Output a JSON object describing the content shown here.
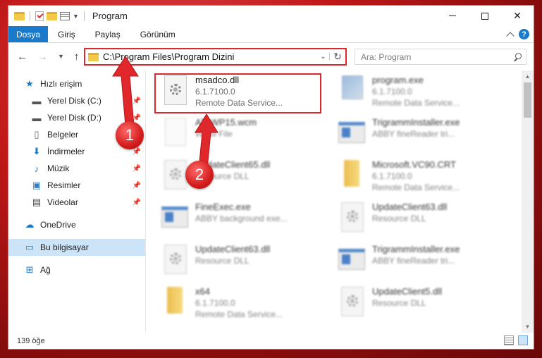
{
  "window": {
    "title": "Program"
  },
  "ribbon": {
    "tabs": [
      "Dosya",
      "Giriş",
      "Paylaş",
      "Görünüm"
    ],
    "help": "?"
  },
  "address": {
    "path": "C:\\Program Files\\Program Dizini"
  },
  "search": {
    "placeholder": "Ara: Program"
  },
  "sidebar": {
    "quick_access": "Hızlı erişim",
    "items": [
      {
        "label": "Yerel Disk (C:)"
      },
      {
        "label": "Yerel Disk (D:)"
      },
      {
        "label": "Belgeler"
      },
      {
        "label": "İndirmeler"
      },
      {
        "label": "Müzik"
      },
      {
        "label": "Resimler"
      },
      {
        "label": "Videolar"
      }
    ],
    "onedrive": "OneDrive",
    "this_pc": "Bu bilgisayar",
    "network": "Ağ"
  },
  "files": [
    {
      "name": "msadco.dll",
      "line1": "6.1.7100.0",
      "line2": "Remote Data Service...",
      "icon": "dll-gear-icon"
    },
    {
      "name": "program.exe",
      "line1": "6.1.7100.0",
      "line2": "Remote Data Service...",
      "icon": "exe-icon"
    },
    {
      "name": "AToWP15.wcm",
      "line1": "WCM File",
      "line2": "",
      "icon": "blank-file-icon"
    },
    {
      "name": "TrigrammInstaller.exe",
      "line1": "ABBY fineReader tri...",
      "line2": "",
      "icon": "window-icon"
    },
    {
      "name": "UpdateClient65.dll",
      "line1": "Resource DLL",
      "line2": "",
      "icon": "dll-gear-icon"
    },
    {
      "name": "Microsoft.VC90.CRT",
      "line1": "6.1.7100.0",
      "line2": "Remote Data Service...",
      "icon": "folder-icon"
    },
    {
      "name": "FineExec.exe",
      "line1": "ABBY background exe...",
      "line2": "",
      "icon": "window-icon"
    },
    {
      "name": "UpdateClient63.dll",
      "line1": "Resource DLL",
      "line2": "",
      "icon": "dll-gear-icon"
    },
    {
      "name": "UpdateClient63.dll",
      "line1": "Resource DLL",
      "line2": "",
      "icon": "dll-gear-icon"
    },
    {
      "name": "TrigrammInstaller.exe",
      "line1": "ABBY fineReader tri...",
      "line2": "",
      "icon": "window-icon"
    },
    {
      "name": "x64",
      "line1": "6.1.7100.0",
      "line2": "Remote Data Service...",
      "icon": "folder-icon"
    },
    {
      "name": "UpdateClient5.dll",
      "line1": "Resource DLL",
      "line2": "",
      "icon": "dll-gear-icon"
    }
  ],
  "status": {
    "count": "139 öğe"
  },
  "annotations": {
    "step1": "1",
    "step2": "2"
  },
  "colors": {
    "accent": "#1979ca",
    "highlight": "#e0272b",
    "selection": "#cce4f7"
  }
}
